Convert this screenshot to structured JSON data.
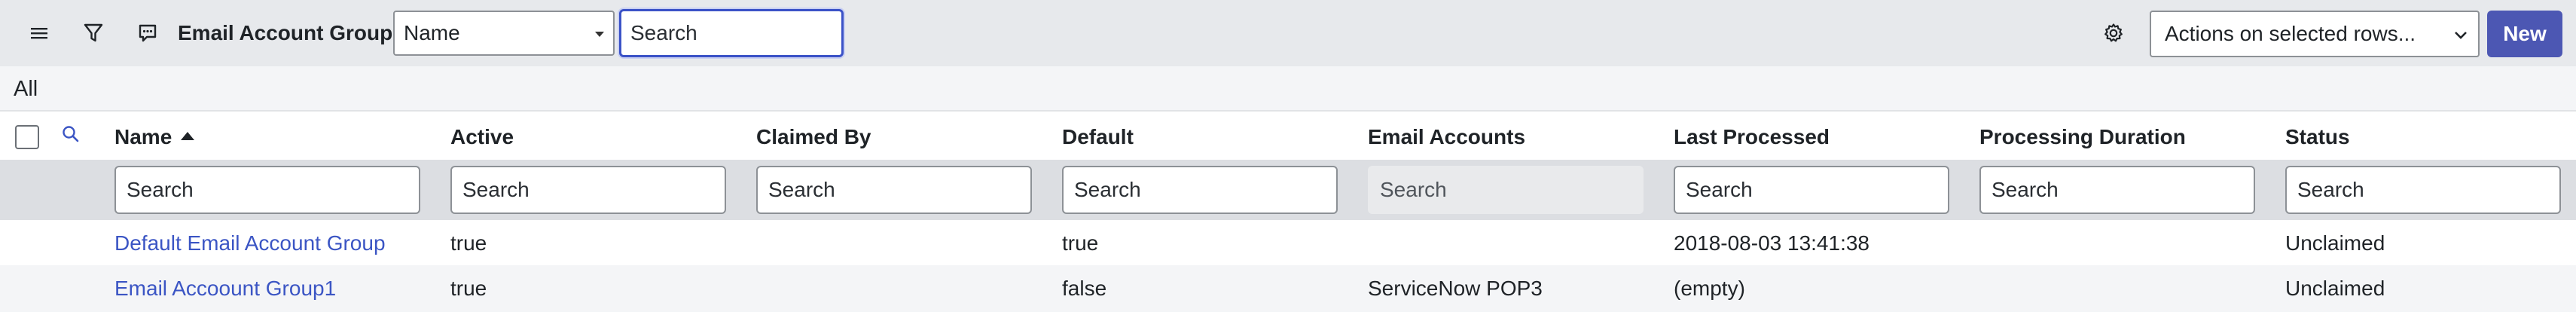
{
  "header": {
    "title": "Email Account Groups",
    "field_select": "Name",
    "search_placeholder": "Search",
    "actions_select": "Actions on selected rows...",
    "new_label": "New",
    "icons": [
      "menu-icon",
      "filter-icon",
      "comment-icon",
      "gear-icon",
      "chevron-down-icon"
    ]
  },
  "breadcrumb": {
    "label": "All"
  },
  "table": {
    "columns": [
      {
        "label": "Name",
        "sorted": "ascending"
      },
      {
        "label": "Active"
      },
      {
        "label": "Claimed By"
      },
      {
        "label": "Default"
      },
      {
        "label": "Email Accounts"
      },
      {
        "label": "Last Processed"
      },
      {
        "label": "Processing Duration"
      },
      {
        "label": "Status"
      }
    ],
    "search_placeholder": "Search",
    "rows": [
      {
        "name": "Default Email Account Group",
        "active": "true",
        "claimed_by": "",
        "default": "true",
        "email_accounts": "",
        "last_processed": "2018-08-03 13:41:38",
        "processing_duration": "",
        "status": "Unclaimed"
      },
      {
        "name": "Email Accoount Group1",
        "active": "true",
        "claimed_by": "",
        "default": "false",
        "email_accounts": "ServiceNow POP3",
        "last_processed": "(empty)",
        "processing_duration": "",
        "status": "Unclaimed"
      }
    ]
  },
  "colors": {
    "header_bg": "#e7e9ec",
    "accent": "#4c57b3",
    "link": "#3b55c4",
    "search_focus": "#3b52c7"
  }
}
